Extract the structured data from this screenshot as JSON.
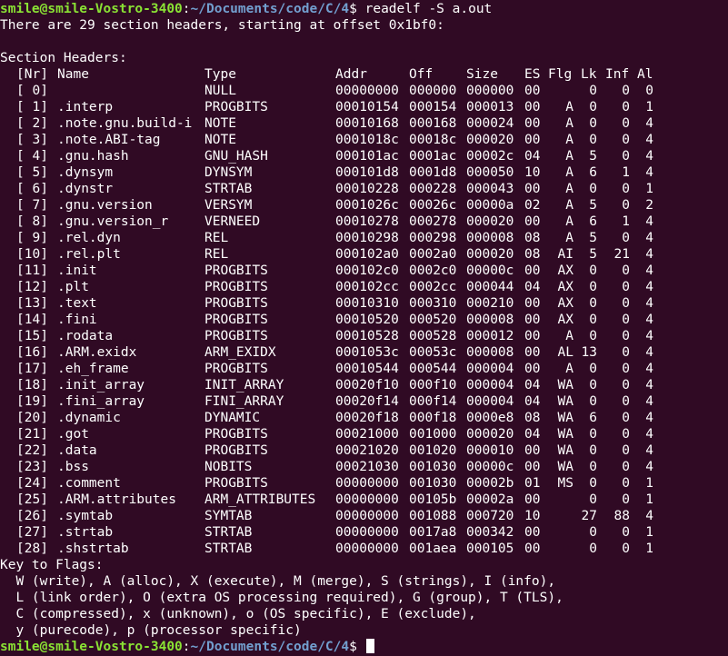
{
  "prompt": {
    "user_host": "smile@smile-Vostro-3400",
    "colon": ":",
    "path": "~/Documents/code/C/4",
    "symbol": "$",
    "command": " readelf -S a.out"
  },
  "intro_line": "There are 29 section headers, starting at offset 0x1bf0:",
  "section_title": "Section Headers:",
  "headers": {
    "nr": "[Nr]",
    "name": "Name",
    "type": "Type",
    "addr": "Addr",
    "off": "Off",
    "size": "Size",
    "es": "ES",
    "flg": "Flg",
    "lk": "Lk",
    "inf": "Inf",
    "al": "Al"
  },
  "sections": [
    {
      "nr": "[ 0]",
      "name": "",
      "type": "NULL",
      "addr": "00000000",
      "off": "000000",
      "size": "000000",
      "es": "00",
      "flg": "",
      "lk": "0",
      "inf": "0",
      "al": "0"
    },
    {
      "nr": "[ 1]",
      "name": ".interp",
      "type": "PROGBITS",
      "addr": "00010154",
      "off": "000154",
      "size": "000013",
      "es": "00",
      "flg": "A",
      "lk": "0",
      "inf": "0",
      "al": "1"
    },
    {
      "nr": "[ 2]",
      "name": ".note.gnu.build-i",
      "type": "NOTE",
      "addr": "00010168",
      "off": "000168",
      "size": "000024",
      "es": "00",
      "flg": "A",
      "lk": "0",
      "inf": "0",
      "al": "4"
    },
    {
      "nr": "[ 3]",
      "name": ".note.ABI-tag",
      "type": "NOTE",
      "addr": "0001018c",
      "off": "00018c",
      "size": "000020",
      "es": "00",
      "flg": "A",
      "lk": "0",
      "inf": "0",
      "al": "4"
    },
    {
      "nr": "[ 4]",
      "name": ".gnu.hash",
      "type": "GNU_HASH",
      "addr": "000101ac",
      "off": "0001ac",
      "size": "00002c",
      "es": "04",
      "flg": "A",
      "lk": "5",
      "inf": "0",
      "al": "4"
    },
    {
      "nr": "[ 5]",
      "name": ".dynsym",
      "type": "DYNSYM",
      "addr": "000101d8",
      "off": "0001d8",
      "size": "000050",
      "es": "10",
      "flg": "A",
      "lk": "6",
      "inf": "1",
      "al": "4"
    },
    {
      "nr": "[ 6]",
      "name": ".dynstr",
      "type": "STRTAB",
      "addr": "00010228",
      "off": "000228",
      "size": "000043",
      "es": "00",
      "flg": "A",
      "lk": "0",
      "inf": "0",
      "al": "1"
    },
    {
      "nr": "[ 7]",
      "name": ".gnu.version",
      "type": "VERSYM",
      "addr": "0001026c",
      "off": "00026c",
      "size": "00000a",
      "es": "02",
      "flg": "A",
      "lk": "5",
      "inf": "0",
      "al": "2"
    },
    {
      "nr": "[ 8]",
      "name": ".gnu.version_r",
      "type": "VERNEED",
      "addr": "00010278",
      "off": "000278",
      "size": "000020",
      "es": "00",
      "flg": "A",
      "lk": "6",
      "inf": "1",
      "al": "4"
    },
    {
      "nr": "[ 9]",
      "name": ".rel.dyn",
      "type": "REL",
      "addr": "00010298",
      "off": "000298",
      "size": "000008",
      "es": "08",
      "flg": "A",
      "lk": "5",
      "inf": "0",
      "al": "4"
    },
    {
      "nr": "[10]",
      "name": ".rel.plt",
      "type": "REL",
      "addr": "000102a0",
      "off": "0002a0",
      "size": "000020",
      "es": "08",
      "flg": "AI",
      "lk": "5",
      "inf": "21",
      "al": "4"
    },
    {
      "nr": "[11]",
      "name": ".init",
      "type": "PROGBITS",
      "addr": "000102c0",
      "off": "0002c0",
      "size": "00000c",
      "es": "00",
      "flg": "AX",
      "lk": "0",
      "inf": "0",
      "al": "4"
    },
    {
      "nr": "[12]",
      "name": ".plt",
      "type": "PROGBITS",
      "addr": "000102cc",
      "off": "0002cc",
      "size": "000044",
      "es": "04",
      "flg": "AX",
      "lk": "0",
      "inf": "0",
      "al": "4"
    },
    {
      "nr": "[13]",
      "name": ".text",
      "type": "PROGBITS",
      "addr": "00010310",
      "off": "000310",
      "size": "000210",
      "es": "00",
      "flg": "AX",
      "lk": "0",
      "inf": "0",
      "al": "4"
    },
    {
      "nr": "[14]",
      "name": ".fini",
      "type": "PROGBITS",
      "addr": "00010520",
      "off": "000520",
      "size": "000008",
      "es": "00",
      "flg": "AX",
      "lk": "0",
      "inf": "0",
      "al": "4"
    },
    {
      "nr": "[15]",
      "name": ".rodata",
      "type": "PROGBITS",
      "addr": "00010528",
      "off": "000528",
      "size": "000012",
      "es": "00",
      "flg": "A",
      "lk": "0",
      "inf": "0",
      "al": "4"
    },
    {
      "nr": "[16]",
      "name": ".ARM.exidx",
      "type": "ARM_EXIDX",
      "addr": "0001053c",
      "off": "00053c",
      "size": "000008",
      "es": "00",
      "flg": "AL",
      "lk": "13",
      "inf": "0",
      "al": "4"
    },
    {
      "nr": "[17]",
      "name": ".eh_frame",
      "type": "PROGBITS",
      "addr": "00010544",
      "off": "000544",
      "size": "000004",
      "es": "00",
      "flg": "A",
      "lk": "0",
      "inf": "0",
      "al": "4"
    },
    {
      "nr": "[18]",
      "name": ".init_array",
      "type": "INIT_ARRAY",
      "addr": "00020f10",
      "off": "000f10",
      "size": "000004",
      "es": "04",
      "flg": "WA",
      "lk": "0",
      "inf": "0",
      "al": "4"
    },
    {
      "nr": "[19]",
      "name": ".fini_array",
      "type": "FINI_ARRAY",
      "addr": "00020f14",
      "off": "000f14",
      "size": "000004",
      "es": "04",
      "flg": "WA",
      "lk": "0",
      "inf": "0",
      "al": "4"
    },
    {
      "nr": "[20]",
      "name": ".dynamic",
      "type": "DYNAMIC",
      "addr": "00020f18",
      "off": "000f18",
      "size": "0000e8",
      "es": "08",
      "flg": "WA",
      "lk": "6",
      "inf": "0",
      "al": "4"
    },
    {
      "nr": "[21]",
      "name": ".got",
      "type": "PROGBITS",
      "addr": "00021000",
      "off": "001000",
      "size": "000020",
      "es": "04",
      "flg": "WA",
      "lk": "0",
      "inf": "0",
      "al": "4"
    },
    {
      "nr": "[22]",
      "name": ".data",
      "type": "PROGBITS",
      "addr": "00021020",
      "off": "001020",
      "size": "000010",
      "es": "00",
      "flg": "WA",
      "lk": "0",
      "inf": "0",
      "al": "4"
    },
    {
      "nr": "[23]",
      "name": ".bss",
      "type": "NOBITS",
      "addr": "00021030",
      "off": "001030",
      "size": "00000c",
      "es": "00",
      "flg": "WA",
      "lk": "0",
      "inf": "0",
      "al": "4"
    },
    {
      "nr": "[24]",
      "name": ".comment",
      "type": "PROGBITS",
      "addr": "00000000",
      "off": "001030",
      "size": "00002b",
      "es": "01",
      "flg": "MS",
      "lk": "0",
      "inf": "0",
      "al": "1"
    },
    {
      "nr": "[25]",
      "name": ".ARM.attributes",
      "type": "ARM_ATTRIBUTES",
      "addr": "00000000",
      "off": "00105b",
      "size": "00002a",
      "es": "00",
      "flg": "",
      "lk": "0",
      "inf": "0",
      "al": "1"
    },
    {
      "nr": "[26]",
      "name": ".symtab",
      "type": "SYMTAB",
      "addr": "00000000",
      "off": "001088",
      "size": "000720",
      "es": "10",
      "flg": "",
      "lk": "27",
      "inf": "88",
      "al": "4"
    },
    {
      "nr": "[27]",
      "name": ".strtab",
      "type": "STRTAB",
      "addr": "00000000",
      "off": "0017a8",
      "size": "000342",
      "es": "00",
      "flg": "",
      "lk": "0",
      "inf": "0",
      "al": "1"
    },
    {
      "nr": "[28]",
      "name": ".shstrtab",
      "type": "STRTAB",
      "addr": "00000000",
      "off": "001aea",
      "size": "000105",
      "es": "00",
      "flg": "",
      "lk": "0",
      "inf": "0",
      "al": "1"
    }
  ],
  "key_lines": [
    "Key to Flags:",
    "  W (write), A (alloc), X (execute), M (merge), S (strings), I (info),",
    "  L (link order), O (extra OS processing required), G (group), T (TLS),",
    "  C (compressed), x (unknown), o (OS specific), E (exclude),",
    "  y (purecode), p (processor specific)"
  ],
  "end_prompt": {
    "user_host": "smile@smile-Vostro-3400",
    "colon": ":",
    "path": "~/Documents/code/C/4",
    "symbol": "$ "
  },
  "colors": {
    "background": "#300a24",
    "text": "#ffffff",
    "user_host": "#8ae234",
    "path": "#729fcf"
  }
}
